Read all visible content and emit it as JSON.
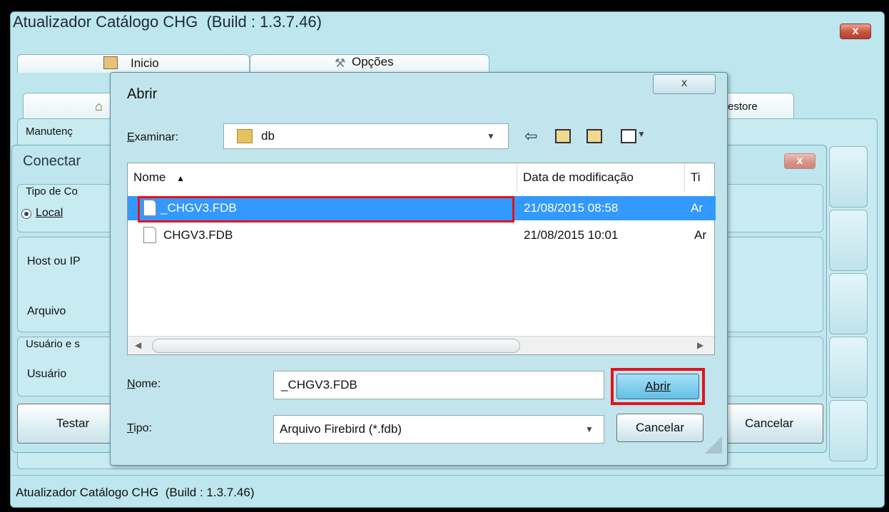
{
  "main": {
    "title": "Atualizador Catálogo CHG  (Build : 1.3.7.46)",
    "tabs": [
      "Inicio",
      "Opções"
    ],
    "inner_tab_right": "estore",
    "group_label": "Manutenç",
    "status_text": "Atualizador Catálogo CHG  (Build : 1.3.7.46)"
  },
  "connect": {
    "title": "Conectar",
    "conn_type_label": "Tipo de Co",
    "local_label": "Local",
    "host_label": "Host ou IP",
    "file_label": "Arquivo",
    "user_group_label": "Usuário e s",
    "user_label": "Usuário",
    "test_button": "Testar",
    "cancel_button": "Cancelar"
  },
  "open_dialog": {
    "title": "Abrir",
    "look_in_label": "Examinar:",
    "look_in_value": "db",
    "columns": [
      "Nome",
      "Data de modificação",
      "Ti"
    ],
    "files": [
      {
        "name": "_CHGV3.FDB",
        "date": "21/08/2015 08:58",
        "type": "Ar"
      },
      {
        "name": "CHGV3.FDB",
        "date": "21/08/2015 10:01",
        "type": "Ar"
      }
    ],
    "name_label": "Nome:",
    "name_value": "_CHGV3.FDB",
    "type_label": "Tipo:",
    "type_value": "Arquivo Firebird (*.fdb)",
    "open_button": "Abrir",
    "cancel_button": "Cancelar",
    "close_glyph": "x"
  },
  "colors": {
    "selection": "#3399ff",
    "highlight": "#e0141e",
    "window_bg": "#bde6ee"
  }
}
